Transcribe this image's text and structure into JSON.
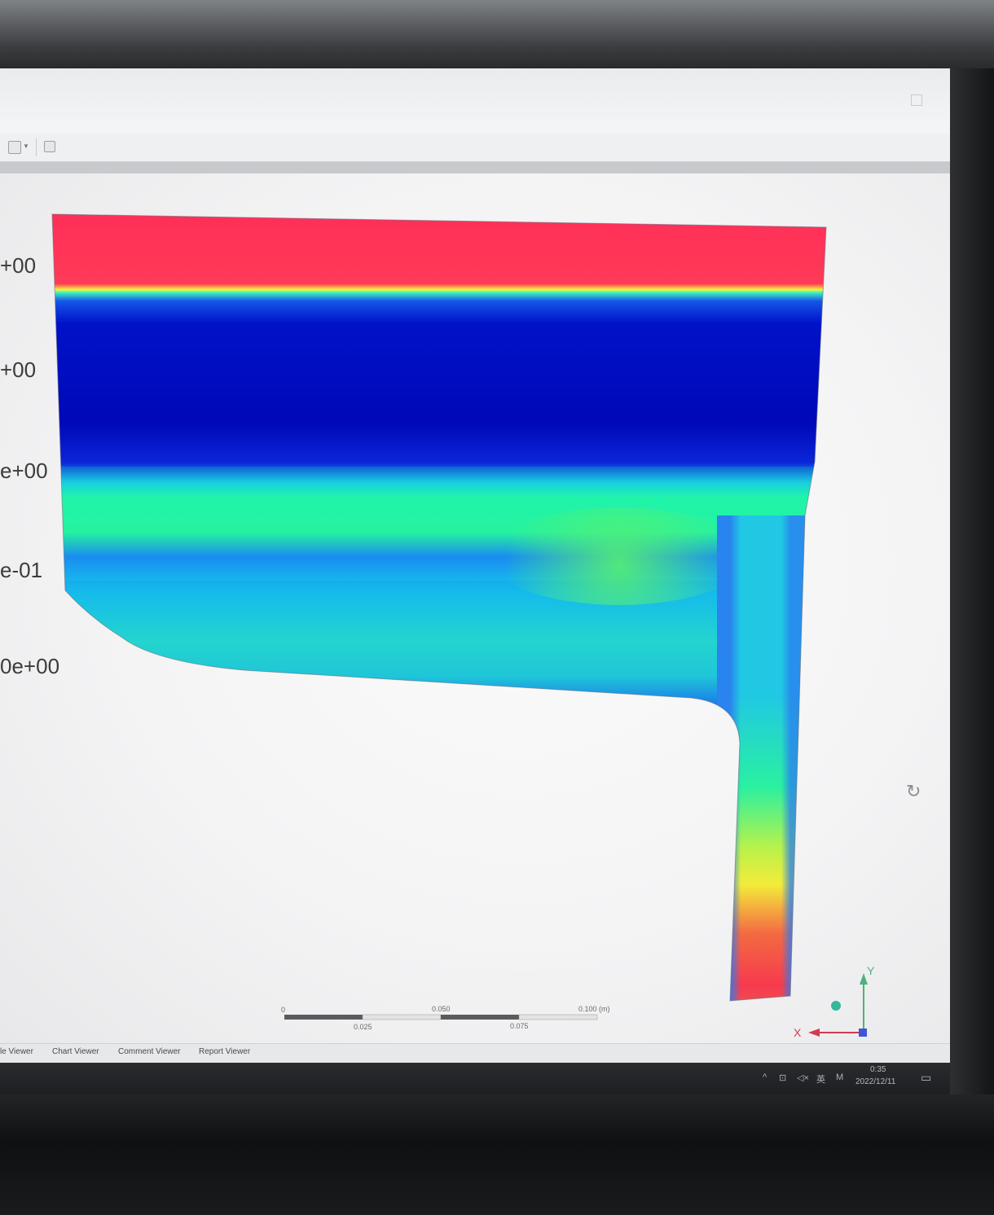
{
  "legend": {
    "labels": [
      "+00",
      "+00",
      "e+00",
      "e-01",
      "0e+00"
    ]
  },
  "viewer_tabs": [
    "le Viewer",
    "Chart Viewer",
    "Comment Viewer",
    "Report Viewer"
  ],
  "scale_bar": {
    "top_ticks": [
      "0",
      "0.050",
      "0.100 (m)"
    ],
    "bottom_ticks": [
      "0.025",
      "0.075"
    ]
  },
  "axes": {
    "x": "X",
    "y": "Y"
  },
  "icons": {
    "refresh": "rotate-view-icon",
    "toolbar_1": "window-icon",
    "toolbar_2": "tree-icon"
  },
  "colors": {
    "hot": "#ff2a55",
    "cold": "#0011c4",
    "mid": "#24f5a0",
    "warm": "#f3f73a"
  },
  "taskbar": {
    "tray": [
      "^",
      "⊡",
      "◁×",
      "英",
      "M"
    ],
    "time": "0:35",
    "date": "2022/12/11"
  }
}
